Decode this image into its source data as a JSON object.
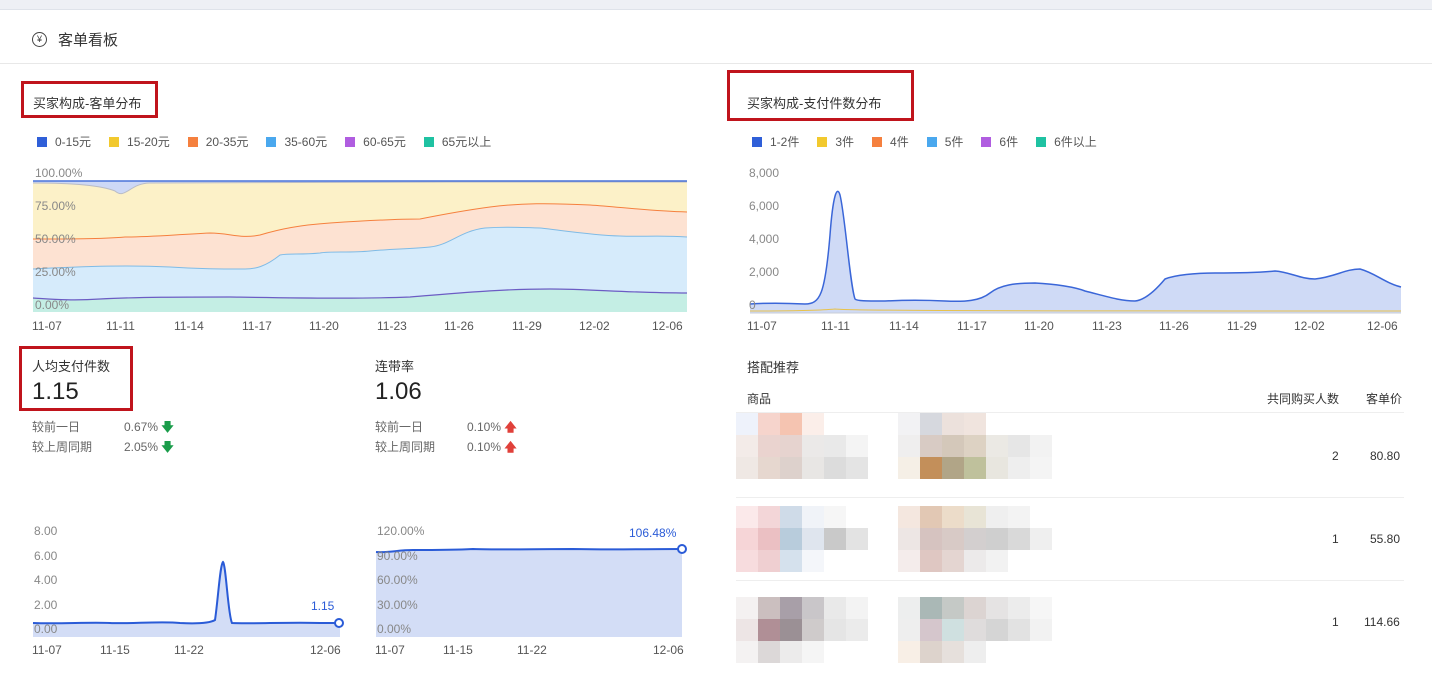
{
  "header": {
    "title": "客单看板",
    "icon": "money-icon"
  },
  "price_chart": {
    "title": "买家构成-客单分布",
    "legend": [
      {
        "label": "0-15元",
        "color": "#2f5fd8"
      },
      {
        "label": "15-20元",
        "color": "#f2c92e"
      },
      {
        "label": "20-35元",
        "color": "#f5803e"
      },
      {
        "label": "35-60元",
        "color": "#4aa8ee"
      },
      {
        "label": "60-65元",
        "color": "#b05de0"
      },
      {
        "label": "65元以上",
        "color": "#1fc2a2"
      }
    ],
    "y_ticks": [
      "100.00%",
      "75.00%",
      "50.00%",
      "25.00%",
      "0.00%"
    ],
    "x_ticks": [
      "11-07",
      "11-11",
      "11-14",
      "11-17",
      "11-20",
      "11-23",
      "11-26",
      "11-29",
      "12-02",
      "12-06"
    ]
  },
  "count_chart": {
    "title": "买家构成-支付件数分布",
    "legend": [
      {
        "label": "1-2件",
        "color": "#2f5fd8"
      },
      {
        "label": "3件",
        "color": "#f2c92e"
      },
      {
        "label": "4件",
        "color": "#f5803e"
      },
      {
        "label": "5件",
        "color": "#4aa8ee"
      },
      {
        "label": "6件",
        "color": "#b05de0"
      },
      {
        "label": "6件以上",
        "color": "#1fc2a2"
      }
    ],
    "y_ticks": [
      "8,000",
      "6,000",
      "4,000",
      "2,000",
      "0"
    ],
    "x_ticks": [
      "11-07",
      "11-11",
      "11-14",
      "11-17",
      "11-20",
      "11-23",
      "11-26",
      "11-29",
      "12-02",
      "12-06"
    ]
  },
  "metric_items": {
    "label": "人均支付件数",
    "value": "1.15",
    "cmp_day_label": "较前一日",
    "cmp_day_value": "0.67%",
    "cmp_week_label": "较上周同期",
    "cmp_week_value": "2.05%",
    "cmp_direction": "down",
    "chart": {
      "y_ticks": [
        "8.00",
        "6.00",
        "4.00",
        "2.00",
        "0.00"
      ],
      "x_ticks": [
        "11-07",
        "11-15",
        "11-22",
        "12-06"
      ],
      "last_value_label": "1.15"
    }
  },
  "metric_rate": {
    "label": "连带率",
    "value": "1.06",
    "cmp_day_label": "较前一日",
    "cmp_day_value": "0.10%",
    "cmp_week_label": "较上周同期",
    "cmp_week_value": "0.10%",
    "cmp_direction": "up",
    "chart": {
      "y_ticks": [
        "120.00%",
        "90.00%",
        "60.00%",
        "30.00%",
        "0.00%"
      ],
      "x_ticks": [
        "11-07",
        "11-15",
        "11-22",
        "12-06"
      ],
      "last_value_label": "106.48%"
    }
  },
  "pairing": {
    "title": "搭配推荐",
    "col_product": "商品",
    "col_buyers": "共同购买人数",
    "col_price": "客单价",
    "rows": [
      {
        "buyers": "2",
        "price": "80.80"
      },
      {
        "buyers": "1",
        "price": "55.80"
      },
      {
        "buyers": "1",
        "price": "114.66"
      }
    ]
  }
}
